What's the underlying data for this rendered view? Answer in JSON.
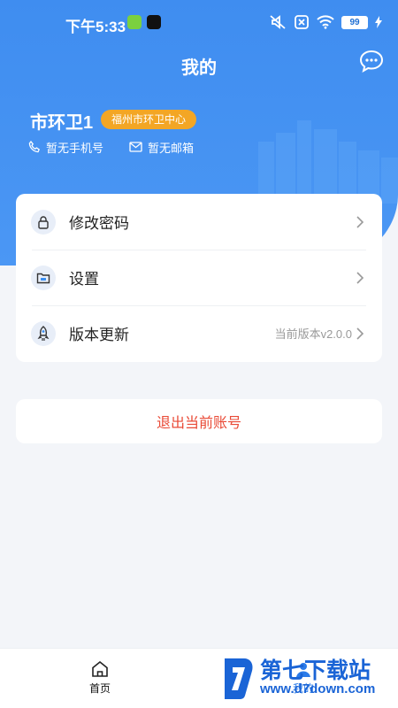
{
  "status_bar": {
    "time": "下午5:33",
    "battery": "99"
  },
  "header": {
    "title": "我的"
  },
  "profile": {
    "name": "市环卫1",
    "org_badge": "福州市环卫中心",
    "phone": "暂无手机号",
    "email": "暂无邮箱"
  },
  "menu": {
    "items": [
      {
        "label": "修改密码",
        "icon": "lock-icon"
      },
      {
        "label": "设置",
        "icon": "folder-icon"
      },
      {
        "label": "版本更新",
        "icon": "rocket-icon",
        "value": "当前版本v2.0.0"
      }
    ]
  },
  "logout": {
    "label": "退出当前账号"
  },
  "tab_bar": {
    "tabs": [
      {
        "label": "首页",
        "icon": "home-icon"
      },
      {
        "label": "我的",
        "icon": "person-icon"
      }
    ]
  },
  "watermark": {
    "title": "第七下载站",
    "url": "www.d7down.com"
  },
  "colors": {
    "primary": "#3f8df0",
    "badge": "#f3a625",
    "logout": "#e94a36",
    "background": "#f3f5f9"
  }
}
